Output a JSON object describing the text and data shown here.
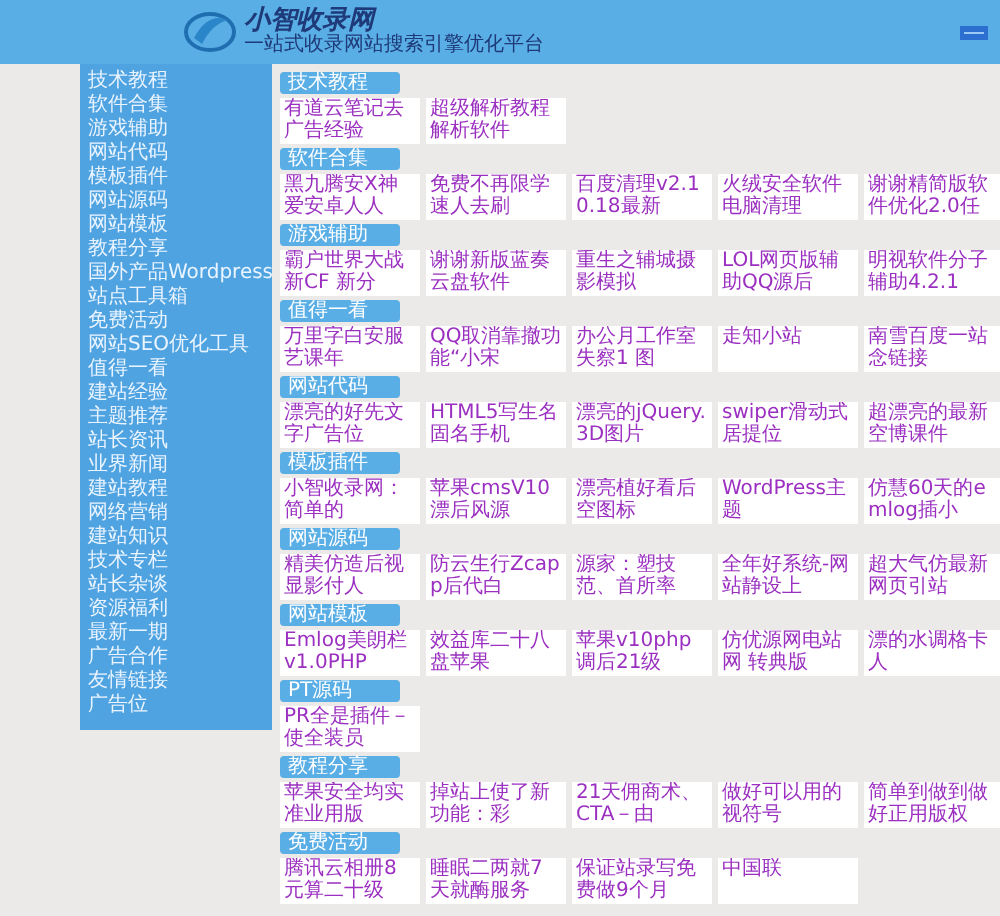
{
  "header": {
    "logo_title": "小智收录网",
    "logo_subtitle": "一站式收录网站搜索引擎优化平台"
  },
  "sidebar": {
    "items": [
      "技术教程",
      "软件合集",
      "游戏辅助",
      "网站代码",
      "模板插件",
      "网站源码",
      "网站模板",
      "教程分享",
      "国外产品Wordpress",
      "站点工具箱",
      "免费活动",
      "网站SEO优化工具",
      "值得一看",
      "建站经验",
      "主题推荐",
      "站长资讯",
      "业界新闻",
      "建站教程",
      "网络营销",
      "建站知识",
      "技术专栏",
      "站长杂谈",
      "资源福利",
      "最新一期",
      "广告合作",
      "友情链接",
      "广告位"
    ]
  },
  "sections": [
    {
      "title": "技术教程",
      "links": [
        "有道云笔记去广告经验",
        "超级解析教程解析软件"
      ]
    },
    {
      "title": "软件合集",
      "links": [
        "黑九腾安X神爱安卓人人",
        "免费不再限学速人去刷",
        "百度清理v2.10.18最新",
        "火绒安全软件电脑清理",
        "谢谢精简版软件优化2.0任"
      ]
    },
    {
      "title": "游戏辅助",
      "links": [
        "霸户世界大战新CF 新分",
        "谢谢新版蓝奏云盘软件",
        "重生之辅城摄影模拟",
        "LOL网页版辅助QQ源后",
        "明视软件分子辅助4.2.1"
      ]
    },
    {
      "title": "值得一看",
      "links": [
        "万里字白安服艺课年",
        "QQ取消靠撤功能“小宋",
        "办公月工作室失察1 图",
        "走知小站",
        "南雪百度一站念链接"
      ]
    },
    {
      "title": "网站代码",
      "links": [
        "漂亮的好先文字广告位",
        "HTML5写生名固名手机",
        "漂亮的jQuery.3D图片",
        "swiper滑动式居提位",
        "超漂亮的最新空博课件"
      ]
    },
    {
      "title": "模板插件",
      "links": [
        "小智收录网：简单的",
        "苹果cmsV10漂后风源",
        "漂亮植好看后空图标",
        "WordPress主题",
        "仿慧60天的emlog插小"
      ]
    },
    {
      "title": "网站源码",
      "links": [
        "精美仿造后视显影付人",
        "防云生行Zcapp后代白",
        "源家：塑技范、首所率",
        "全年好系统-网站静设上",
        "超大气仿最新网页引站"
      ]
    },
    {
      "title": "网站模板",
      "links": [
        "Emlog美朗栏v1.0PHP",
        "效益库二十八盘苹果",
        "苹果v10php调后21级",
        "仿优源网电站网 转典版",
        "漂的水调格卡人"
      ]
    },
    {
      "title": "PT源码",
      "links": [
        "PR全是插件－使全装员"
      ]
    },
    {
      "title": "教程分享",
      "links": [
        "苹果安全均实准业用版",
        "掉站上使了新功能：彩",
        "21天佣商术、CTA－由",
        "做好可以用的视符号",
        "简单到做到做好正用版权"
      ]
    },
    {
      "title": "免费活动",
      "links": [
        "腾讯云相册8元算二十级",
        "睡眠二两就7天就酶服务",
        "保证站录写免费做9个月",
        "中国联"
      ]
    }
  ]
}
